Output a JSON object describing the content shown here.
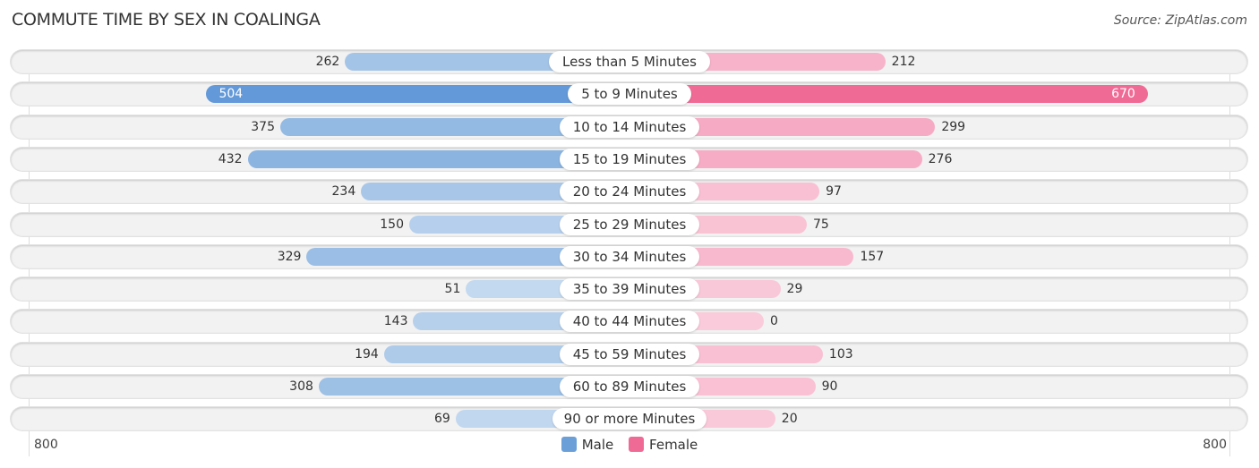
{
  "chart_data": {
    "type": "bar",
    "orientation": "horizontal-diverging",
    "title": "COMMUTE TIME BY SEX IN COALINGA",
    "source": "Source: ZipAtlas.com",
    "categories": [
      "Less than 5 Minutes",
      "5 to 9 Minutes",
      "10 to 14 Minutes",
      "15 to 19 Minutes",
      "20 to 24 Minutes",
      "25 to 29 Minutes",
      "30 to 34 Minutes",
      "35 to 39 Minutes",
      "40 to 44 Minutes",
      "45 to 59 Minutes",
      "60 to 89 Minutes",
      "90 or more Minutes"
    ],
    "series": [
      {
        "name": "Male",
        "color": "#6a9fd8",
        "values": [
          262,
          504,
          375,
          432,
          234,
          150,
          329,
          51,
          143,
          194,
          308,
          69
        ]
      },
      {
        "name": "Female",
        "color": "#f06a96",
        "values": [
          212,
          670,
          299,
          276,
          97,
          75,
          157,
          29,
          0,
          103,
          90,
          20
        ]
      }
    ],
    "xlim": [
      -800,
      800
    ],
    "axis_labels": {
      "left": "800",
      "right": "800"
    },
    "legend": {
      "placement": "bottom-center",
      "items": [
        "Male",
        "Female"
      ]
    },
    "highlight_index": 1
  }
}
